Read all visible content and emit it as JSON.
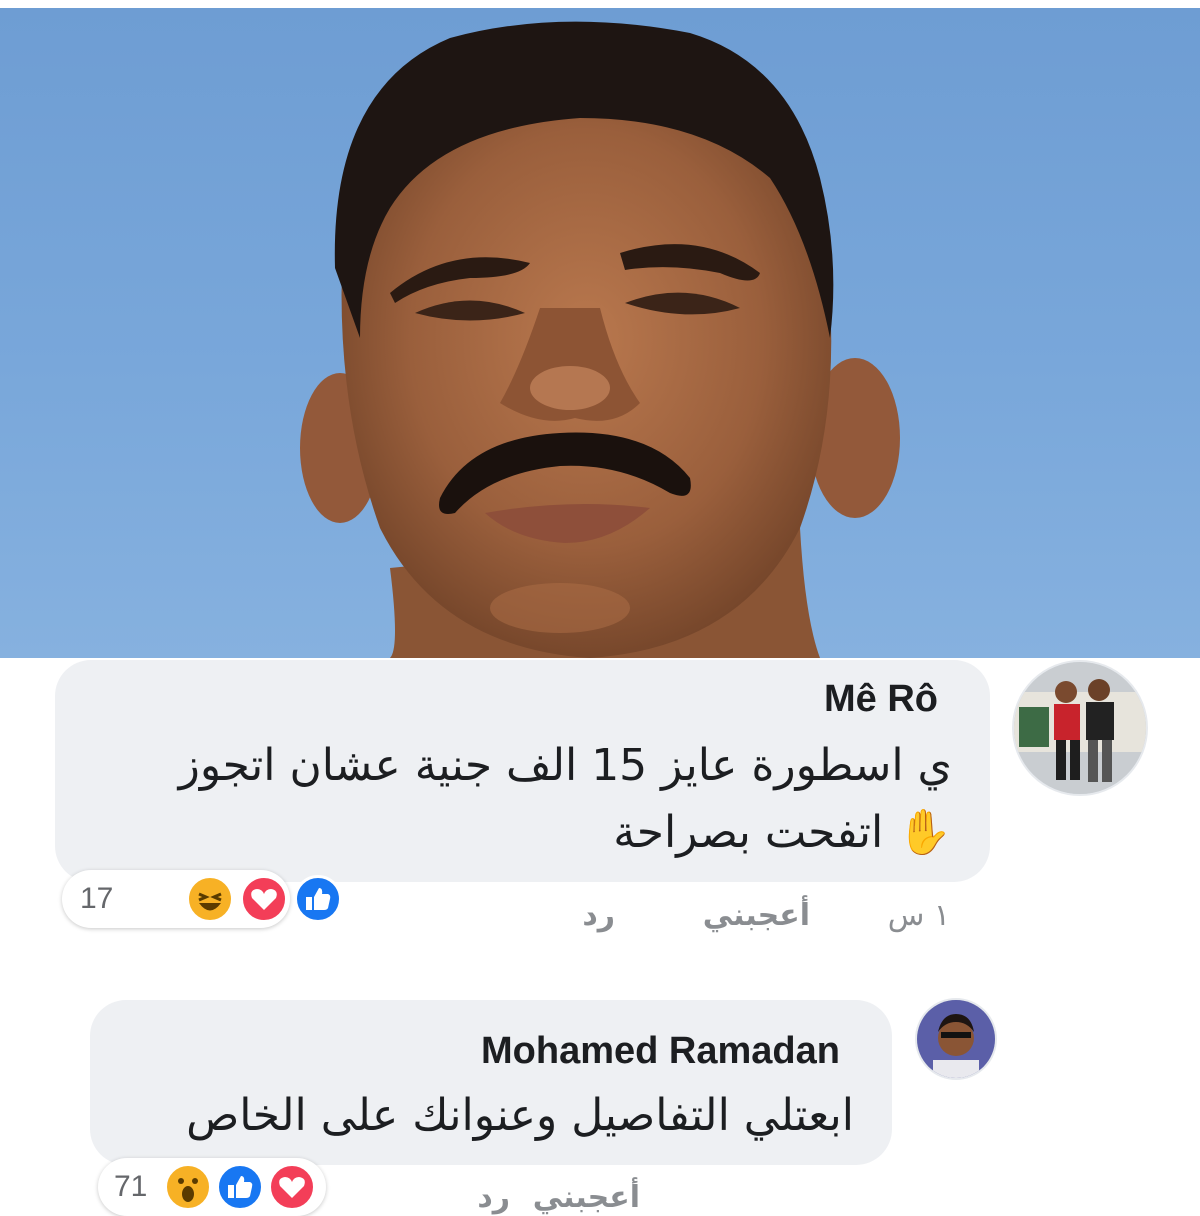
{
  "colors": {
    "sky": "#79a7da",
    "bubble": "#eef0f3",
    "like": "#1877f2",
    "love": "#f33e58",
    "haha": "#f7b125",
    "meta_text": "#8a8d91"
  },
  "photo": {
    "subject_icon": "portrait-photo"
  },
  "comments": [
    {
      "author": "Mê Rô",
      "text_line1": "ي اسطورة عايز 15 الف جنية عشان اتجوز",
      "text_line2": "اتفحت بصراحة",
      "emoji": "✋",
      "time": "١ س",
      "like_label": "أعجبني",
      "reply_label": "رد",
      "reaction_count": "17",
      "reaction_icons": [
        "like-icon",
        "love-icon",
        "haha-icon"
      ]
    },
    {
      "author": "Mohamed Ramadan",
      "text_line1": "ابعتلي التفاصيل وعنوانك على الخاص",
      "time": "",
      "like_label": "أعجبني",
      "reply_label": "رد",
      "reaction_count": "71",
      "reaction_icons": [
        "love-icon",
        "like-icon",
        "wow-icon"
      ]
    }
  ]
}
